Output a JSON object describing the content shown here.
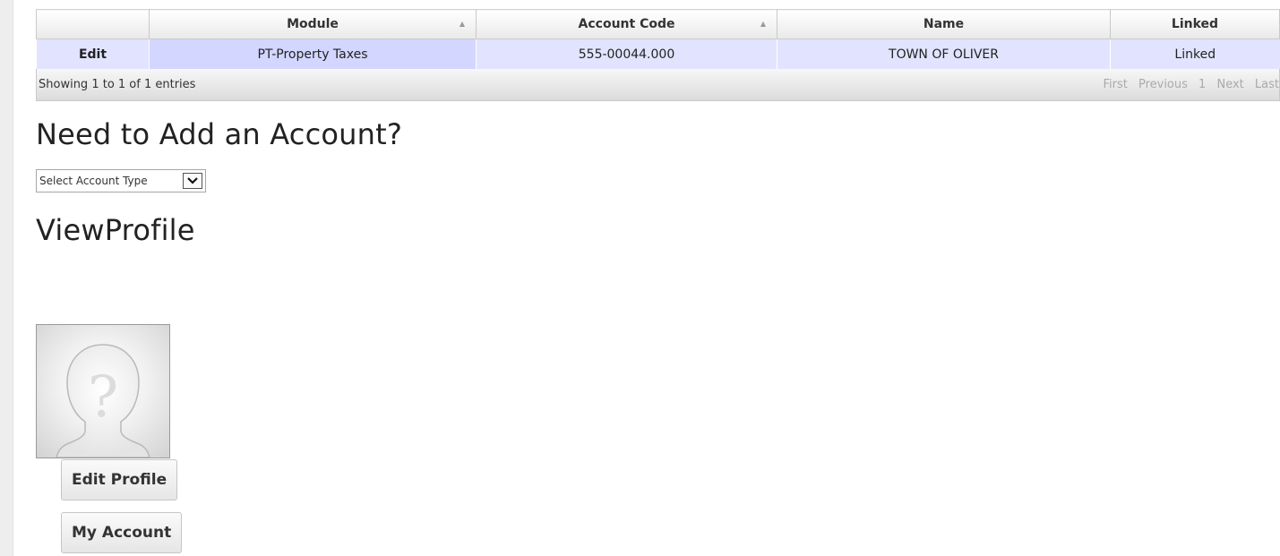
{
  "table": {
    "columns": [
      {
        "label": "",
        "sortable": false
      },
      {
        "label": "Module",
        "sortable": true
      },
      {
        "label": "Account Code",
        "sortable": true
      },
      {
        "label": "Name",
        "sortable": false
      },
      {
        "label": "Linked",
        "sortable": false
      }
    ],
    "rows": [
      {
        "edit": "Edit",
        "module": "PT-Property Taxes",
        "account_code": "555-00044.000",
        "name": "TOWN OF OLIVER",
        "linked": "Linked"
      }
    ],
    "info": "Showing 1 to 1 of 1 entries",
    "pager": {
      "first": "First",
      "previous": "Previous",
      "page": "1",
      "next": "Next",
      "last": "Last"
    }
  },
  "add_account": {
    "heading": "Need to Add an Account?",
    "select_value": "Select Account Type"
  },
  "profile": {
    "heading": "ViewProfile",
    "avatar_icon": "unknown-user-silhouette-icon",
    "edit_button": "Edit Profile",
    "account_button": "My Account"
  },
  "colors": {
    "row_bg": "#e2e4ff",
    "sorted_col_bg": "#d3d6ff",
    "pager_disabled": "#aaaaaa"
  }
}
